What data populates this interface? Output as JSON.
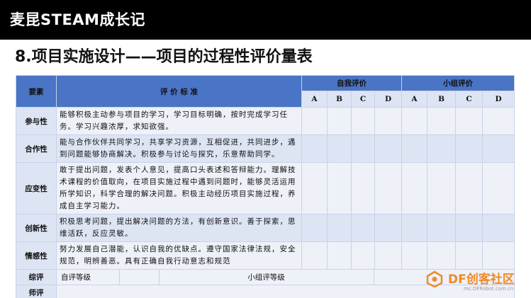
{
  "top_title": "麦昆STEAM成长记",
  "heading": "8.项目实施设计——项目的过程性评价量表",
  "table": {
    "col_element": "要素",
    "col_criteria": "评 价 标 准",
    "group_self": "自我评价",
    "group_team": "小组评价",
    "grades": [
      "A",
      "B",
      "C",
      "D"
    ],
    "rows": [
      {
        "element": "参与性",
        "criteria": "能够积极主动参与项目的学习，学习目标明确，按时完成学习任务。学习兴趣浓厚，求知欲强。"
      },
      {
        "element": "合作性",
        "criteria": "能与合作伙伴共同学习，共享学习资源，互相促进，共同进步，遇到问题能够协商解决。积极参与讨论与探究，乐意帮助同学。"
      },
      {
        "element": "应变性",
        "criteria": "敢于提出问题，发表个人意见，提高口头表述和答辩能力。理解技术课程的价值取向，在项目实施过程中遇到问题时，能够灵活运用所学知识，科学合理的解决问题。积极主动经历项目实施过程，养成自主学习能力。"
      },
      {
        "element": "创新性",
        "criteria": "积极思考问题，提出解决问题的方法，有创新意识。善于探索，思维活跃，反应灵敏。"
      },
      {
        "element": "情感性",
        "criteria": "努力发展自己潜能，认识自我的优缺点。遵守国家法律法规，安全规范，明辨善恶。具有正确自我行动意志和规范"
      }
    ],
    "summary_label": "综评",
    "summary_self": "自评等级",
    "summary_team": "小组评等级",
    "teacher_label": "师评"
  },
  "logo": {
    "brand": "DF创客社区",
    "url": "mc.DFRobot.com.cn",
    "accent": "#f08a24"
  }
}
